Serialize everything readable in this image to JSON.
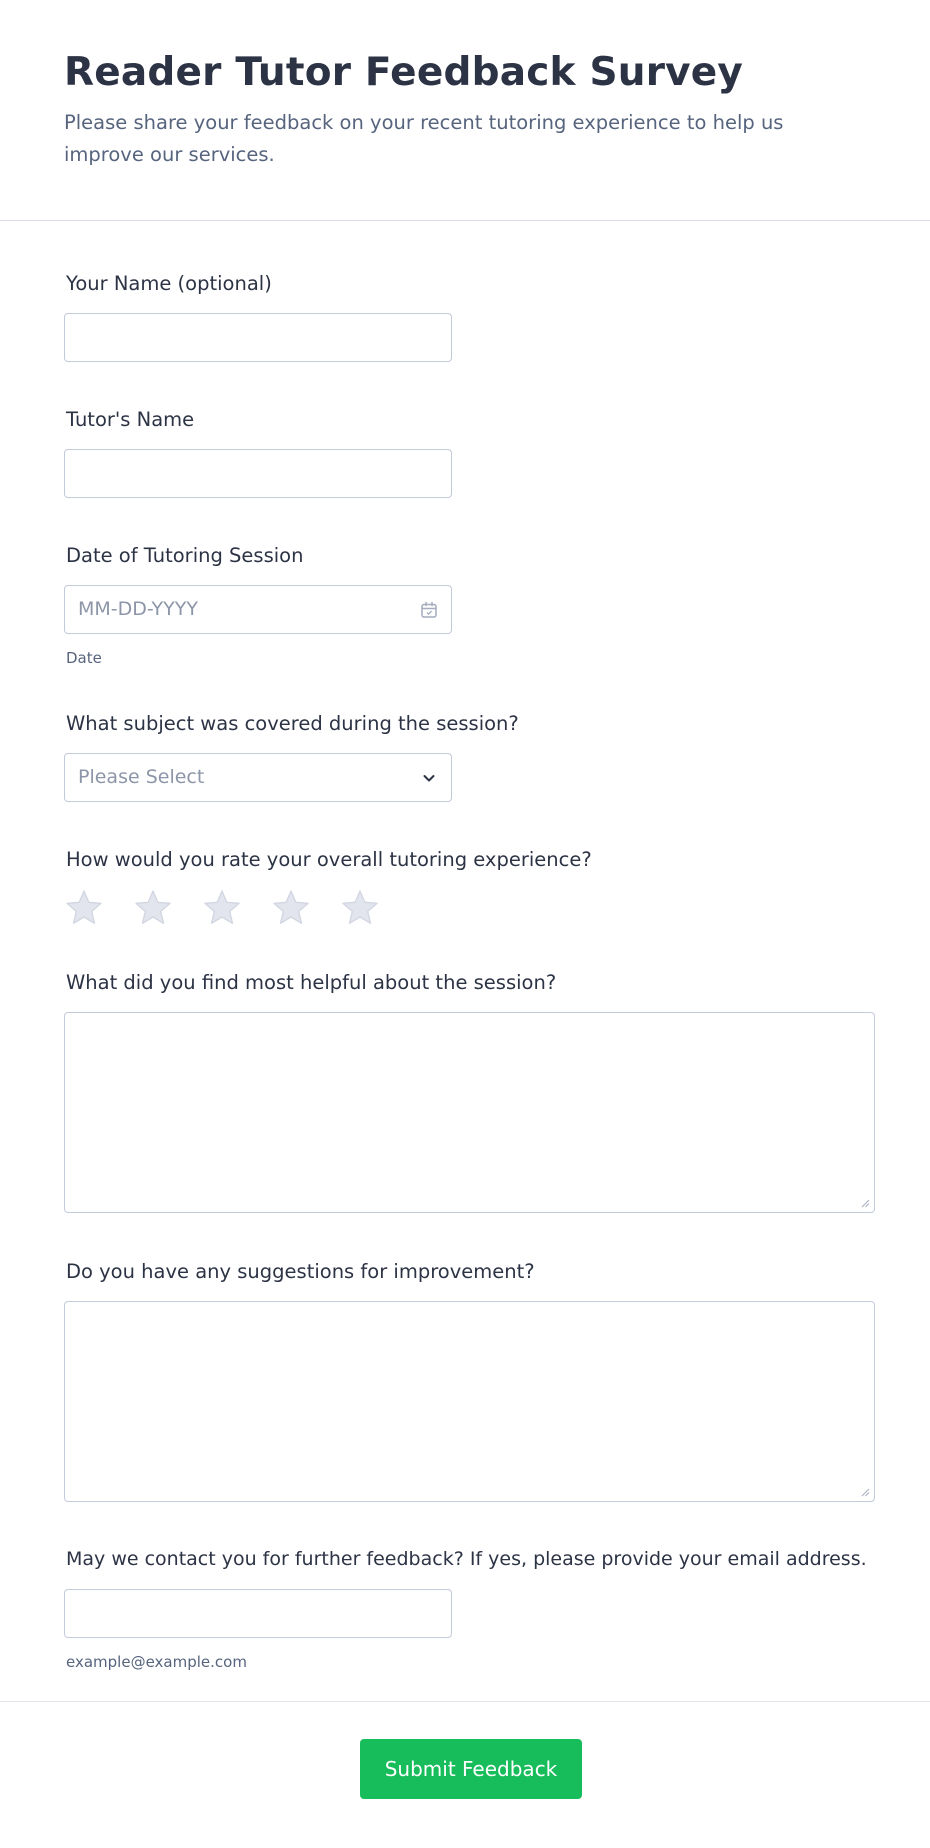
{
  "form": {
    "title": "Reader Tutor Feedback Survey",
    "subtitle": "Please share your feedback on your recent tutoring experience to help us improve our services."
  },
  "fields": {
    "name": {
      "label": "Your Name (optional)",
      "value": ""
    },
    "tutor": {
      "label": "Tutor's Name",
      "value": ""
    },
    "date": {
      "label": "Date of Tutoring Session",
      "placeholder": "MM-DD-YYYY",
      "sublabel": "Date",
      "icon": "calendar-icon"
    },
    "subject": {
      "label": "What subject was covered during the session?",
      "placeholder": "Please Select",
      "icon": "chevron-down-icon"
    },
    "rating": {
      "label": "How would you rate your overall tutoring experience?",
      "max": 5,
      "value": 0
    },
    "helpful": {
      "label": "What did you find most helpful about the session?",
      "value": ""
    },
    "suggestions": {
      "label": "Do you have any suggestions for improvement?",
      "value": ""
    },
    "email": {
      "label": "May we contact you for further feedback? If yes, please provide your email address.",
      "sublabel": "example@example.com",
      "value": ""
    }
  },
  "submit": {
    "label": "Submit Feedback"
  },
  "colors": {
    "accent": "#18bd5b",
    "border": "#c3cad8",
    "star_empty": "#e3e5ee",
    "text": "#2c3345",
    "muted": "#57647e"
  }
}
